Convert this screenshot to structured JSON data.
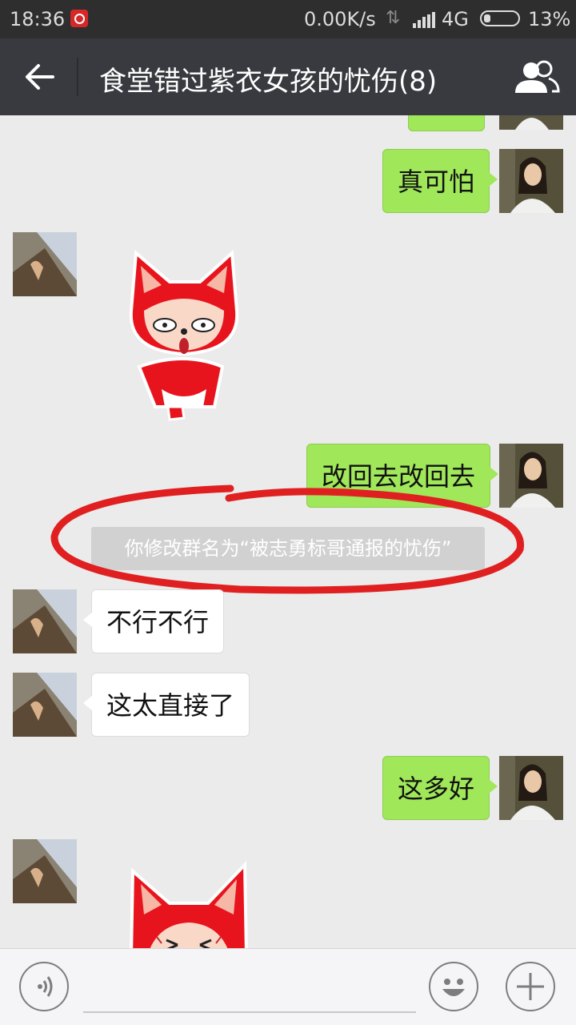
{
  "status_bar": {
    "time": "18:36",
    "speed": "0.00K/s",
    "network": "4G",
    "battery": "13%"
  },
  "header": {
    "title": "食堂错过紫衣女孩的忧伤(8)"
  },
  "messages": {
    "m1": "真可怕",
    "m2": "改回去改回去",
    "system": "你修改群名为“被志勇标哥通报的忧伤”",
    "m3": "不行不行",
    "m4": "这太直接了",
    "m5": "这多好"
  },
  "colors": {
    "title_bar": "#393a3f",
    "status_bar": "#2e2e2e",
    "chat_background": "#ebebeb",
    "sent_bubble": "#a0e75a",
    "received_bubble": "#ffffff",
    "annotation": "#e02020"
  },
  "icons": [
    "back-arrow-icon",
    "group-members-icon",
    "voice-icon",
    "emoji-icon",
    "plus-icon",
    "sticker-red-fox"
  ]
}
